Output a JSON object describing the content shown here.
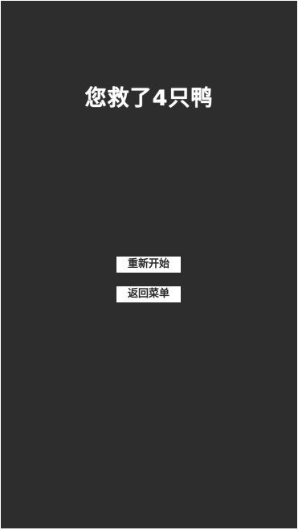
{
  "result": {
    "title": "您救了4只鸭"
  },
  "buttons": {
    "restart_label": "重新开始",
    "back_to_menu_label": "返回菜单"
  },
  "colors": {
    "background": "#2d2d2d",
    "title_text": "#ffffff",
    "button_background": "#ffffff",
    "button_text": "#2a2a2a"
  }
}
